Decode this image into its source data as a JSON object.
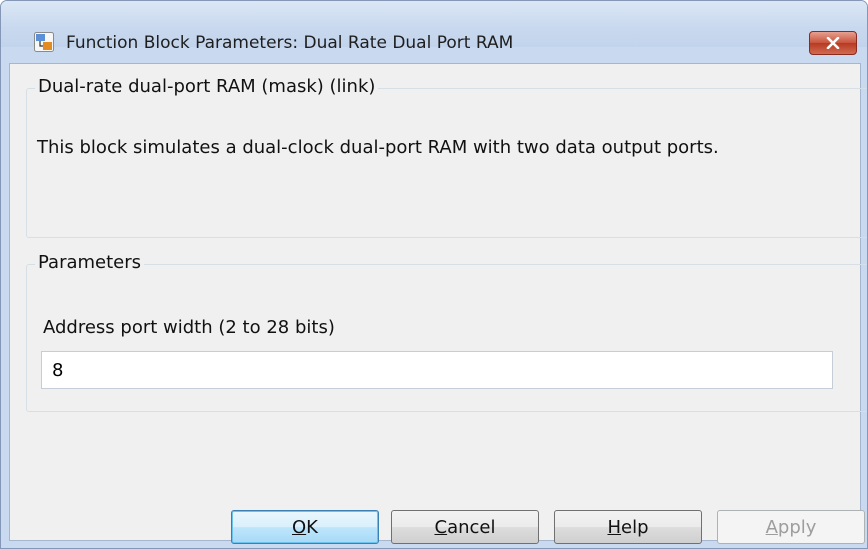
{
  "window": {
    "title": "Function Block Parameters: Dual Rate Dual Port RAM",
    "close_icon": "close-icon"
  },
  "description": {
    "group_title": "Dual-rate dual-port RAM (mask) (link)",
    "text": "This block simulates a dual-clock dual-port RAM with two data output ports."
  },
  "parameters": {
    "group_title": "Parameters",
    "address_label": "Address port width (2 to 28 bits)",
    "address_value": "8"
  },
  "buttons": {
    "ok": {
      "mnemonic": "O",
      "rest": "K"
    },
    "cancel": {
      "mnemonic": "C",
      "rest": "ancel"
    },
    "help": {
      "mnemonic": "H",
      "rest": "elp"
    },
    "apply": {
      "mnemonic": "A",
      "rest": "pply",
      "enabled": false
    }
  },
  "colors": {
    "frame": "#c9daf0",
    "client": "#f0f0f0",
    "close_button": "#c8523b",
    "default_button_border": "#3c7fb1"
  }
}
